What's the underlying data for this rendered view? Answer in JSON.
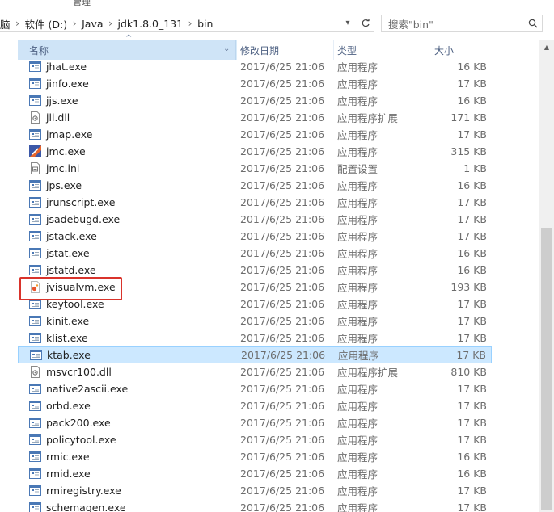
{
  "ribbon": {
    "tab_partial": "管理"
  },
  "address": {
    "crumbs": [
      "脑",
      "软件 (D:)",
      "Java",
      "jdk1.8.0_131",
      "bin"
    ]
  },
  "search": {
    "placeholder": "搜索\"bin\""
  },
  "columns": {
    "name": "名称",
    "date": "修改日期",
    "type": "类型",
    "size": "大小"
  },
  "files": [
    {
      "name": "jhat.exe",
      "date": "2017/6/25 21:06",
      "type": "应用程序",
      "size": "16 KB",
      "icon": "exe-icon"
    },
    {
      "name": "jinfo.exe",
      "date": "2017/6/25 21:06",
      "type": "应用程序",
      "size": "17 KB",
      "icon": "exe-icon"
    },
    {
      "name": "jjs.exe",
      "date": "2017/6/25 21:06",
      "type": "应用程序",
      "size": "16 KB",
      "icon": "exe-icon"
    },
    {
      "name": "jli.dll",
      "date": "2017/6/25 21:06",
      "type": "应用程序扩展",
      "size": "171 KB",
      "icon": "dll-icon"
    },
    {
      "name": "jmap.exe",
      "date": "2017/6/25 21:06",
      "type": "应用程序",
      "size": "17 KB",
      "icon": "exe-icon"
    },
    {
      "name": "jmc.exe",
      "date": "2017/6/25 21:06",
      "type": "应用程序",
      "size": "315 KB",
      "icon": "jmc-icon"
    },
    {
      "name": "jmc.ini",
      "date": "2017/6/25 21:06",
      "type": "配置设置",
      "size": "1 KB",
      "icon": "ini-icon"
    },
    {
      "name": "jps.exe",
      "date": "2017/6/25 21:06",
      "type": "应用程序",
      "size": "16 KB",
      "icon": "exe-icon"
    },
    {
      "name": "jrunscript.exe",
      "date": "2017/6/25 21:06",
      "type": "应用程序",
      "size": "17 KB",
      "icon": "exe-icon"
    },
    {
      "name": "jsadebugd.exe",
      "date": "2017/6/25 21:06",
      "type": "应用程序",
      "size": "17 KB",
      "icon": "exe-icon"
    },
    {
      "name": "jstack.exe",
      "date": "2017/6/25 21:06",
      "type": "应用程序",
      "size": "17 KB",
      "icon": "exe-icon"
    },
    {
      "name": "jstat.exe",
      "date": "2017/6/25 21:06",
      "type": "应用程序",
      "size": "16 KB",
      "icon": "exe-icon"
    },
    {
      "name": "jstatd.exe",
      "date": "2017/6/25 21:06",
      "type": "应用程序",
      "size": "16 KB",
      "icon": "exe-icon"
    },
    {
      "name": "jvisualvm.exe",
      "date": "2017/6/25 21:06",
      "type": "应用程序",
      "size": "193 KB",
      "icon": "jvisualvm-icon"
    },
    {
      "name": "keytool.exe",
      "date": "2017/6/25 21:06",
      "type": "应用程序",
      "size": "17 KB",
      "icon": "exe-icon"
    },
    {
      "name": "kinit.exe",
      "date": "2017/6/25 21:06",
      "type": "应用程序",
      "size": "17 KB",
      "icon": "exe-icon"
    },
    {
      "name": "klist.exe",
      "date": "2017/6/25 21:06",
      "type": "应用程序",
      "size": "17 KB",
      "icon": "exe-icon"
    },
    {
      "name": "ktab.exe",
      "date": "2017/6/25 21:06",
      "type": "应用程序",
      "size": "17 KB",
      "icon": "exe-icon",
      "selected": true
    },
    {
      "name": "msvcr100.dll",
      "date": "2017/6/25 21:06",
      "type": "应用程序扩展",
      "size": "810 KB",
      "icon": "dll-icon"
    },
    {
      "name": "native2ascii.exe",
      "date": "2017/6/25 21:06",
      "type": "应用程序",
      "size": "17 KB",
      "icon": "exe-icon"
    },
    {
      "name": "orbd.exe",
      "date": "2017/6/25 21:06",
      "type": "应用程序",
      "size": "17 KB",
      "icon": "exe-icon"
    },
    {
      "name": "pack200.exe",
      "date": "2017/6/25 21:06",
      "type": "应用程序",
      "size": "17 KB",
      "icon": "exe-icon"
    },
    {
      "name": "policytool.exe",
      "date": "2017/6/25 21:06",
      "type": "应用程序",
      "size": "17 KB",
      "icon": "exe-icon"
    },
    {
      "name": "rmic.exe",
      "date": "2017/6/25 21:06",
      "type": "应用程序",
      "size": "16 KB",
      "icon": "exe-icon"
    },
    {
      "name": "rmid.exe",
      "date": "2017/6/25 21:06",
      "type": "应用程序",
      "size": "16 KB",
      "icon": "exe-icon"
    },
    {
      "name": "rmiregistry.exe",
      "date": "2017/6/25 21:06",
      "type": "应用程序",
      "size": "17 KB",
      "icon": "exe-icon"
    },
    {
      "name": "schemagen.exe",
      "date": "2017/6/25 21:06",
      "type": "应用程序",
      "size": "17 KB",
      "icon": "exe-icon"
    }
  ],
  "colors": {
    "selection_bg": "#cce8ff",
    "selection_border": "#99d1ff",
    "header_sorted_bg": "#cfe4f7",
    "annotation_red": "#d9332b"
  },
  "annotation": {
    "target": "jvisualvm.exe"
  }
}
